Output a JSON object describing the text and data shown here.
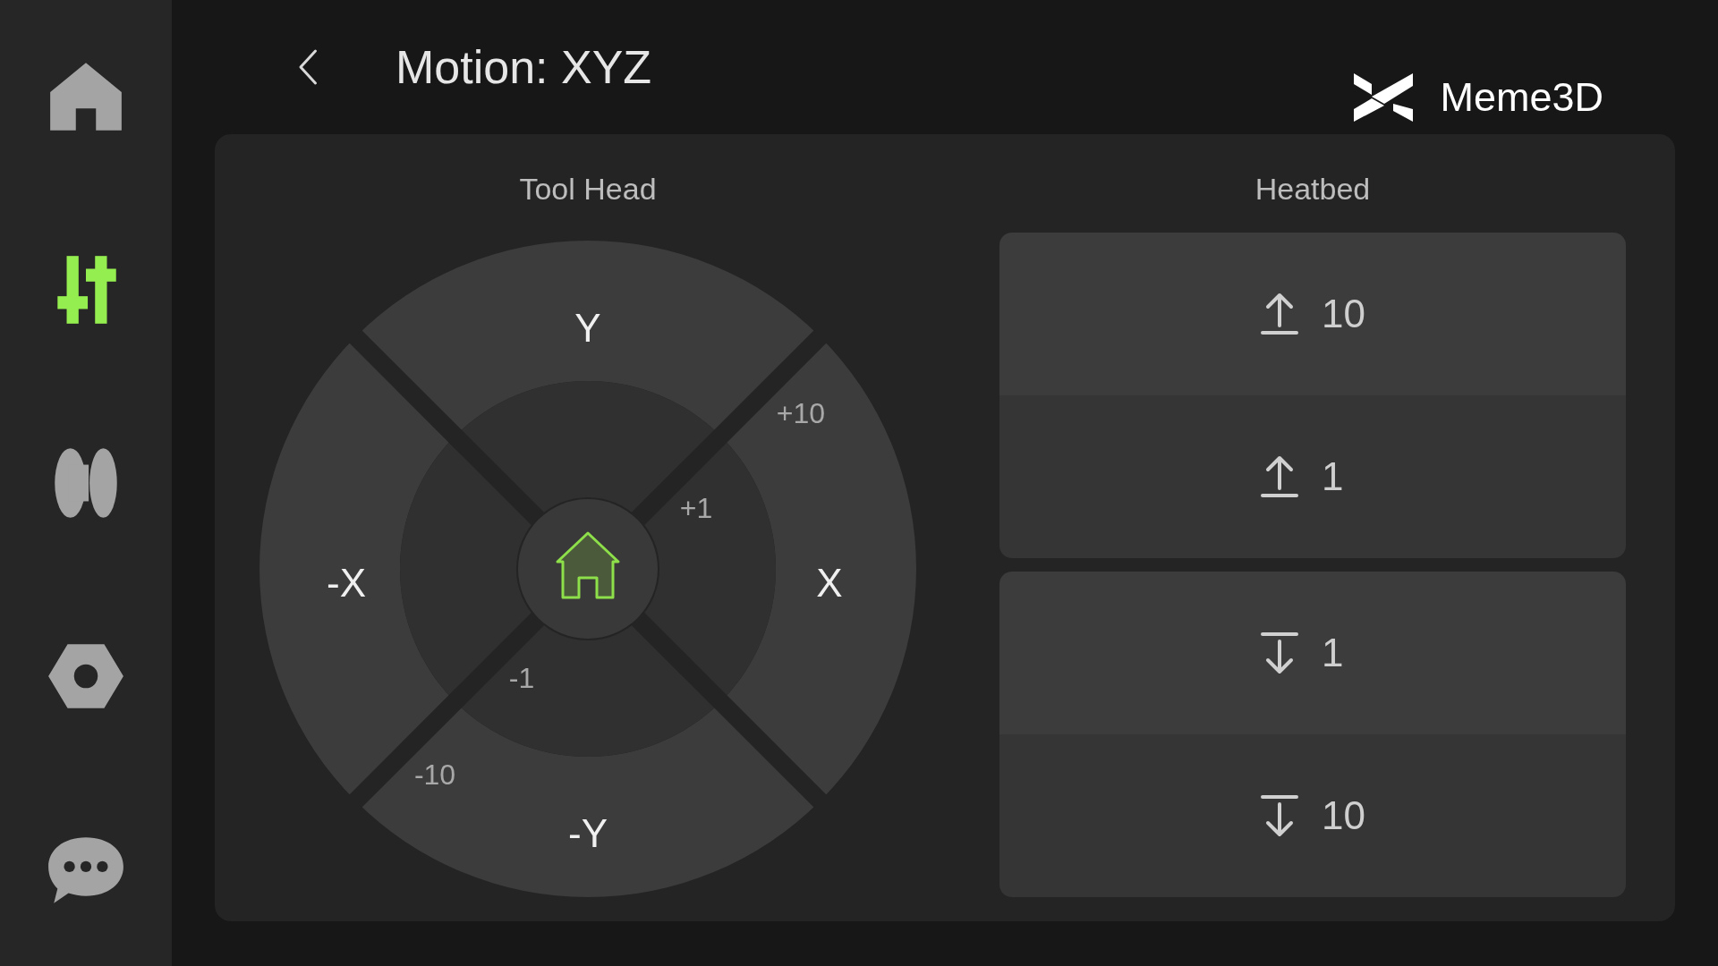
{
  "sidebar": {
    "items": [
      {
        "kind": "home",
        "selected": false
      },
      {
        "kind": "motion",
        "selected": true
      },
      {
        "kind": "filament",
        "selected": false
      },
      {
        "kind": "settings",
        "selected": false
      },
      {
        "kind": "chat",
        "selected": false
      }
    ]
  },
  "header": {
    "title": "Motion: XYZ",
    "brand": "Meme3D"
  },
  "tool_head": {
    "title": "Tool Head",
    "axes": [
      {
        "label": "Y"
      },
      {
        "label": "-X"
      },
      {
        "label": "X"
      },
      {
        "label": "-Y"
      }
    ],
    "steps": [
      {
        "label": "+10"
      },
      {
        "label": "+1"
      },
      {
        "label": "-1"
      },
      {
        "label": "-10"
      }
    ]
  },
  "heatbed": {
    "title": "Heatbed",
    "buttons": [
      {
        "kind": "up",
        "label": "10"
      },
      {
        "kind": "up",
        "label": "1"
      },
      {
        "kind": "down",
        "label": "1"
      },
      {
        "kind": "down",
        "label": "10"
      }
    ]
  }
}
